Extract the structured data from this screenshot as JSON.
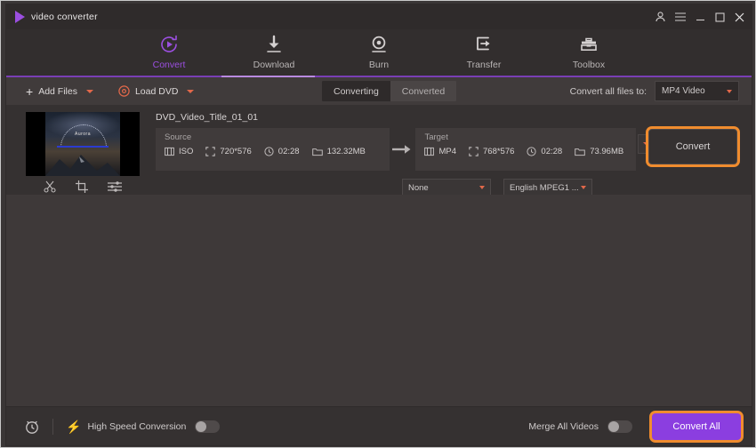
{
  "app": {
    "title": "video converter",
    "logo_icon": "play-triangle-icon"
  },
  "window_controls": [
    {
      "name": "account-icon",
      "glyph": "person"
    },
    {
      "name": "menu-icon",
      "glyph": "hamburger"
    },
    {
      "name": "minimize-button",
      "glyph": "minimize"
    },
    {
      "name": "maximize-button",
      "glyph": "maximize"
    },
    {
      "name": "close-button",
      "glyph": "close"
    }
  ],
  "nav": {
    "items": [
      {
        "label": "Convert",
        "icon": "convert-circular-arrow-play-icon",
        "active": true
      },
      {
        "label": "Download",
        "icon": "download-arrow-icon",
        "active": false
      },
      {
        "label": "Burn",
        "icon": "burn-disc-icon",
        "active": false
      },
      {
        "label": "Transfer",
        "icon": "transfer-arrow-icon",
        "active": false
      },
      {
        "label": "Toolbox",
        "icon": "toolbox-icon",
        "active": false
      }
    ]
  },
  "toolbar": {
    "add_files_label": "Add Files",
    "load_dvd_label": "Load DVD",
    "tabs": [
      {
        "label": "Converting",
        "active": true
      },
      {
        "label": "Converted",
        "active": false
      }
    ],
    "convert_all_to_label": "Convert all files to:",
    "convert_all_to_value": "MP4 Video"
  },
  "file": {
    "name": "DVD_Video_Title_01_01",
    "thumbnail_caption": "Aurora",
    "edit_tools": [
      {
        "name": "trim-icon",
        "label": "Trim"
      },
      {
        "name": "crop-icon",
        "label": "Crop"
      },
      {
        "name": "effects-icon",
        "label": "Effects"
      }
    ],
    "source": {
      "label": "Source",
      "format": "ISO",
      "resolution": "720*576",
      "duration": "02:28",
      "size": "132.32MB"
    },
    "target": {
      "label": "Target",
      "format": "MP4",
      "resolution": "768*576",
      "duration": "02:28",
      "size": "73.96MB"
    },
    "subtitle_value": "None",
    "audio_value": "English MPEG1 ...",
    "convert_button": "Convert"
  },
  "bottom": {
    "timer_icon": "alarm-clock-icon",
    "high_speed_label": "High Speed Conversion",
    "high_speed_on": false,
    "merge_label": "Merge All Videos",
    "merge_on": false,
    "convert_all_button": "Convert All"
  },
  "colors": {
    "accent_purple": "#9b4fe0",
    "button_purple": "#8b3ee0",
    "highlight_orange": "#f08c2e",
    "caret_red": "#e2684a",
    "bg_dark": "#3a3636"
  }
}
